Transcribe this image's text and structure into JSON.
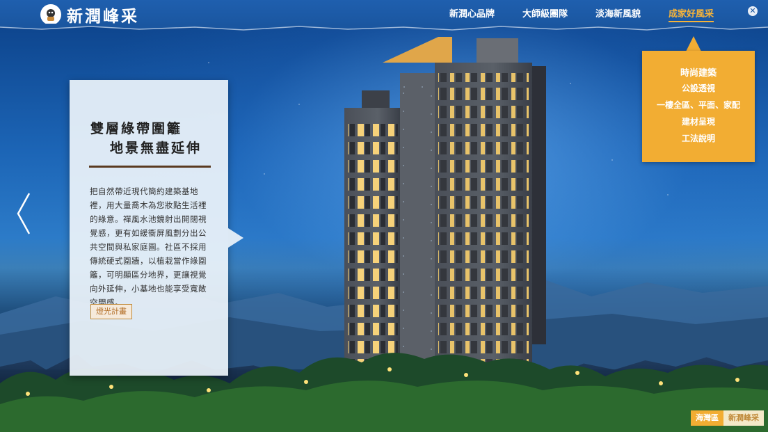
{
  "brand": {
    "logo_text": "新潤峰采"
  },
  "nav": {
    "items": [
      {
        "label": "新潤心品牌"
      },
      {
        "label": "大師級團隊"
      },
      {
        "label": "淡海新風貌"
      },
      {
        "label": "成家好風采"
      }
    ],
    "active_index": 3,
    "close_symbol": "✕"
  },
  "submenu": {
    "items": [
      "時尚建築",
      "公設透視",
      "一樓全區、平面、家配",
      "建材呈現",
      "工法說明"
    ]
  },
  "card": {
    "title_line1": "雙層綠帶圍籬",
    "title_line2": "地景無盡延伸",
    "body": "把自然帶近現代簡約建築基地裡，用大量喬木為您妝點生活裡的綠意。禪風水池鏡射出開闊視覺感，更有如緩衝屏風劃分出公共空間與私家庭園。社區不採用傳統硬式圍牆，以植栽當作綠圍籬，可明顯區分地界，更讓視覺向外延伸，小基地也能享受寬敞空間感。",
    "button_label": "燈光計畫"
  },
  "footer_tag": {
    "area": "海灣區",
    "project": "新潤峰采"
  },
  "colors": {
    "accent": "#f2ad33",
    "nav_bg": "#1a56a0",
    "card_bg": "#ecf3fa"
  }
}
